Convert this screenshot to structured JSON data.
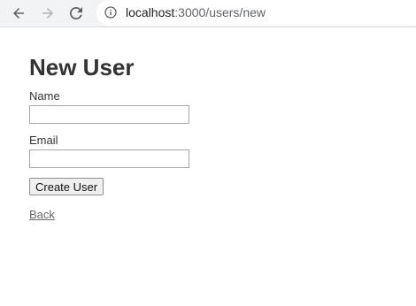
{
  "browser": {
    "url_host": "localhost",
    "url_rest": ":3000/users/new",
    "icons": {
      "back": "arrow-left-icon",
      "forward": "arrow-right-icon",
      "reload": "reload-icon",
      "info": "info-icon"
    }
  },
  "page": {
    "title": "New User",
    "form": {
      "name_label": "Name",
      "name_value": "",
      "email_label": "Email",
      "email_value": "",
      "submit_label": "Create User"
    },
    "back_link": "Back"
  }
}
